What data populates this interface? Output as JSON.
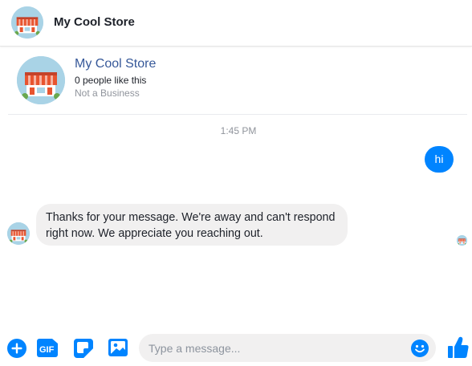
{
  "header": {
    "title": "My Cool Store"
  },
  "profile": {
    "name": "My Cool Store",
    "likes": "0 people like this",
    "category": "Not a Business"
  },
  "conversation": {
    "timestamp": "1:45 PM",
    "messages": [
      {
        "from": "me",
        "text": "hi"
      },
      {
        "from": "page",
        "text": "Thanks for your message. We're away and can't respond right now. We appreciate you reaching out."
      }
    ]
  },
  "composer": {
    "placeholder": "Type a message...",
    "value": "",
    "icons": [
      "plus-circle-icon",
      "gif-icon",
      "sticker-icon",
      "image-icon",
      "emoji-icon",
      "thumbs-up-icon"
    ]
  },
  "colors": {
    "accent": "#0084ff",
    "link": "#365899",
    "bubble_in": "#f1f0f0",
    "avatar_bg": "#a9d3e6",
    "storefront": "#e8542f"
  }
}
